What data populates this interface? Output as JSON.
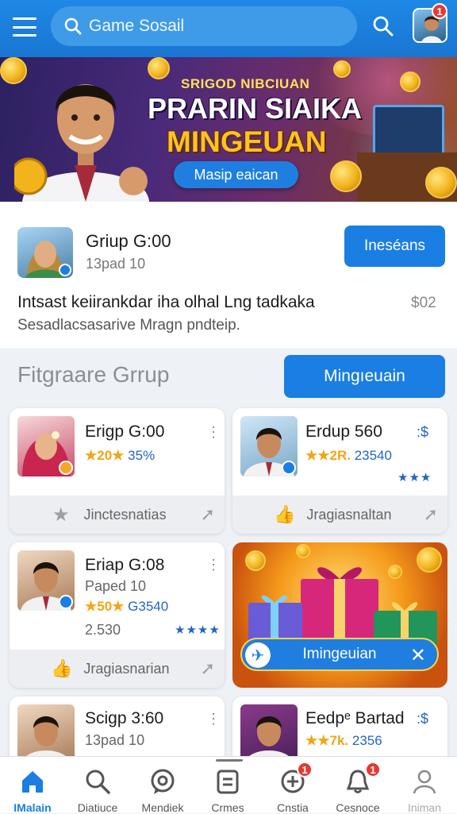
{
  "header": {
    "search_text": "Game Sosail",
    "notif_count": "1",
    "icons": [
      "menu-icon",
      "search-icon",
      "avatar"
    ]
  },
  "banner": {
    "subtitle": "SRIGOD NIBCIUAN",
    "title_line1": "PRARIN SIAIKA",
    "title_line2": "MINGEUAN",
    "button_label": "Masip eaican"
  },
  "group": {
    "name": "Griup G:00",
    "meta": "13pad 10",
    "join_label": "Ineséans",
    "description": "Intsast keiirankdar iha olhal Lng tadkaka",
    "price": "$02",
    "sub_description": "Sesadlacsasarive Mragn pndteip."
  },
  "section": {
    "title": "Fitgraare Grrup",
    "button_label": "Mingıeuain"
  },
  "cards": [
    {
      "name": "Erigp G:00",
      "rating": "20",
      "rating_extra": "35%",
      "footer_label": "Jinctesnatias",
      "footer_icon": "star-icon"
    },
    {
      "name": "Erdup 560",
      "rating": "2R.",
      "rating_extra": "23540",
      "stars": "★★★",
      "footer_label": "Jragiasnaltan",
      "footer_icon": "thumbs-up-icon",
      "menu": ":$"
    },
    {
      "name": "Eriap G:08",
      "sub": "Paped 10",
      "rating": "50",
      "rating_extra": "G3540",
      "price": "2.530",
      "stars": "★★★★",
      "footer_label": "Jragiasnarian",
      "footer_icon": "thumbs-up-icon"
    },
    {
      "name": "Scigp 3:60",
      "sub": "13pad 10"
    },
    {
      "name": "Eedpᵉ Bartad",
      "rating": "7k.",
      "rating_extra": "2356",
      "menu": ":$"
    }
  ],
  "promo": {
    "label": "Imingeuian"
  },
  "bottom_nav": [
    {
      "label": "IMalain",
      "icon": "home-icon",
      "active": true
    },
    {
      "label": "Diatiuce",
      "icon": "search-icon"
    },
    {
      "label": "Mendiek",
      "icon": "chat-bubble-icon"
    },
    {
      "label": "Crmes",
      "icon": "list-icon"
    },
    {
      "label": "Cnstia",
      "icon": "plus-circle-icon",
      "badge": "1"
    },
    {
      "label": "Cesnoce",
      "icon": "bell-icon",
      "badge": "1"
    },
    {
      "label": "Iniman",
      "icon": "profile-icon"
    }
  ],
  "colors": {
    "primary": "#1a7ee3",
    "accent": "#f2a516",
    "badge": "#e53935"
  }
}
